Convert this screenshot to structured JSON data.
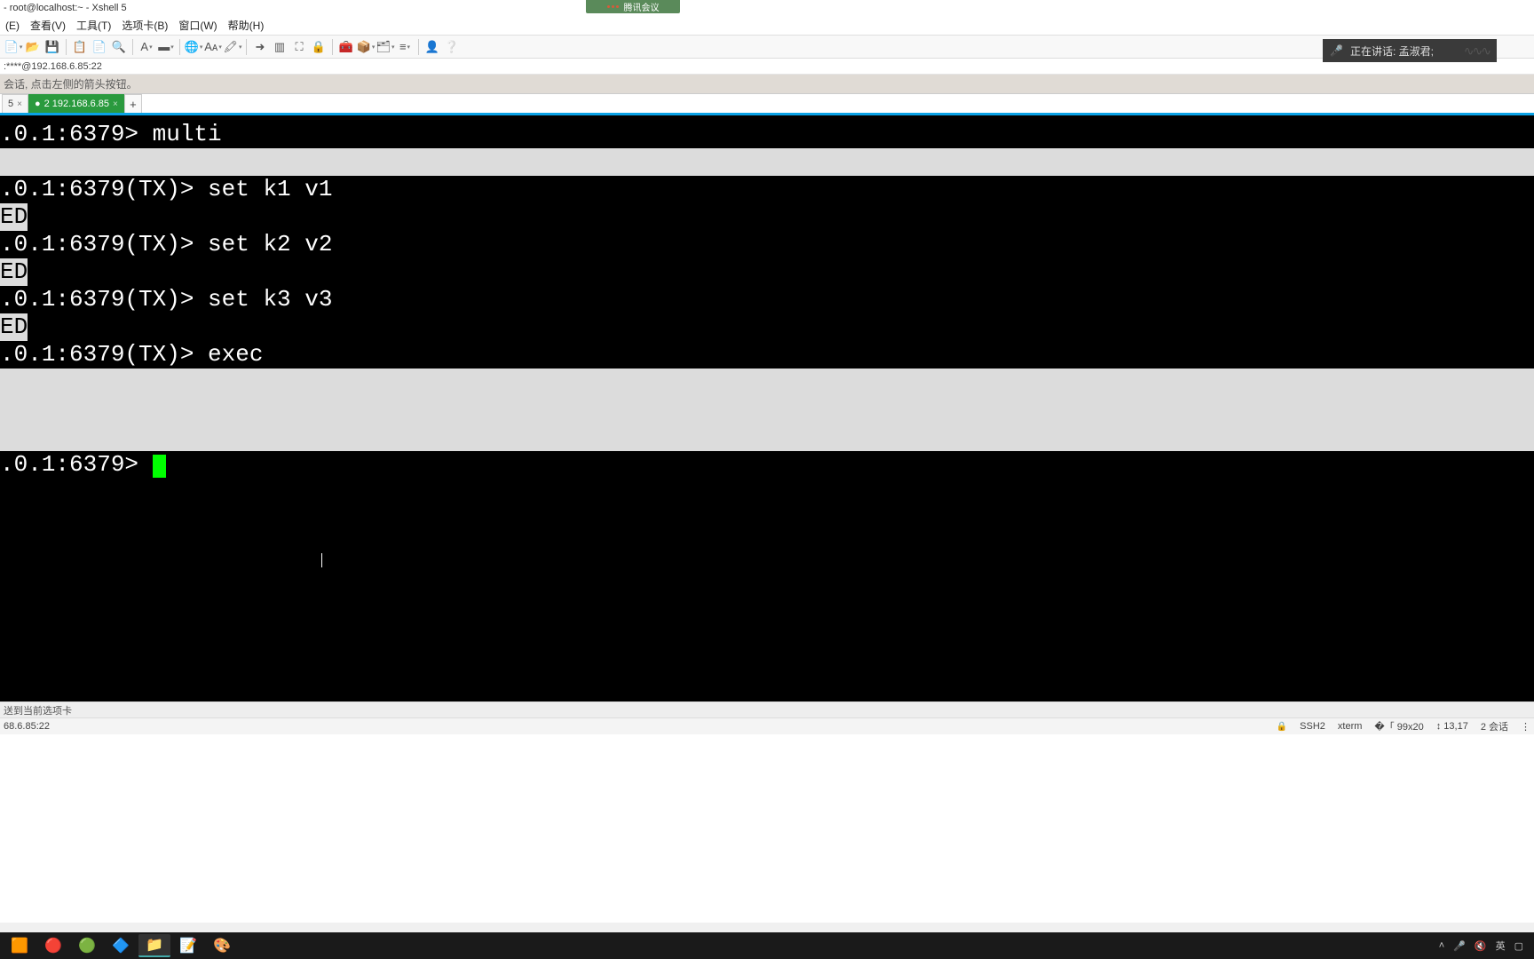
{
  "window": {
    "title": "- root@localhost:~ - Xshell 5"
  },
  "meeting": {
    "label": "腾讯会议"
  },
  "menu": {
    "items": [
      "(E)",
      "查看(V)",
      "工具(T)",
      "选项卡(B)",
      "窗口(W)",
      "帮助(H)"
    ]
  },
  "voice": {
    "label": "正在讲话: 孟淑君;"
  },
  "conn": {
    "text": ":****@192.168.6.85:22"
  },
  "hint": {
    "text": "会话, 点击左侧的箭头按钮。"
  },
  "tabs": {
    "items": [
      {
        "label": "5",
        "active": false
      },
      {
        "label": "2 192.168.6.85",
        "active": true
      }
    ]
  },
  "terminal": {
    "lines": [
      {
        "t": ".0.1:6379> multi",
        "sel": false
      },
      {
        "t": "",
        "sel": true,
        "selwide": true
      },
      {
        "t": ".0.1:6379(TX)> set k1 v1",
        "sel": false
      },
      {
        "t": "ED",
        "sel": true
      },
      {
        "t": ".0.1:6379(TX)> set k2 v2",
        "sel": false
      },
      {
        "t": "ED",
        "sel": true
      },
      {
        "t": ".0.1:6379(TX)> set k3 v3",
        "sel": false
      },
      {
        "t": "ED",
        "sel": true
      },
      {
        "t": ".0.1:6379(TX)> exec",
        "sel": false
      },
      {
        "t": "",
        "sel": true,
        "selwide": true
      },
      {
        "t": "",
        "sel": true,
        "selwide": true
      },
      {
        "t": "",
        "sel": true,
        "selwide": true
      },
      {
        "t": ".0.1:6379> ",
        "sel": false,
        "cursor": true
      }
    ]
  },
  "tip": {
    "text": "送到当前选项卡"
  },
  "status": {
    "left": "68.6.85:22",
    "proto": "SSH2",
    "term": "xterm",
    "size": "99x20",
    "pos": "13,17",
    "sess": "2 会话"
  },
  "tray": {
    "ime": "英"
  },
  "icons": {
    "new": "📄",
    "open": "📂",
    "save": "💾",
    "clip1": "📋",
    "clip2": "📄",
    "find": "🔍",
    "font": "A",
    "color_bar": "▬",
    "globe": "🌐",
    "fonta": "Aᴀ",
    "highlight": "🖍",
    "full": "⛶",
    "lock": "🔒",
    "tools": "🧰",
    "box": "📦",
    "calc": "🗂",
    "list": "≡",
    "user": "👤",
    "help": "❔"
  },
  "task": {
    "items": [
      {
        "name": "app-vm",
        "glyph": "🟧"
      },
      {
        "name": "app-red",
        "glyph": "🔴"
      },
      {
        "name": "app-green",
        "glyph": "🟢"
      },
      {
        "name": "app-blue",
        "glyph": "🔷"
      },
      {
        "name": "file-explorer",
        "glyph": "📁"
      },
      {
        "name": "text-editor",
        "glyph": "📝"
      },
      {
        "name": "paint",
        "glyph": "🎨"
      }
    ]
  }
}
